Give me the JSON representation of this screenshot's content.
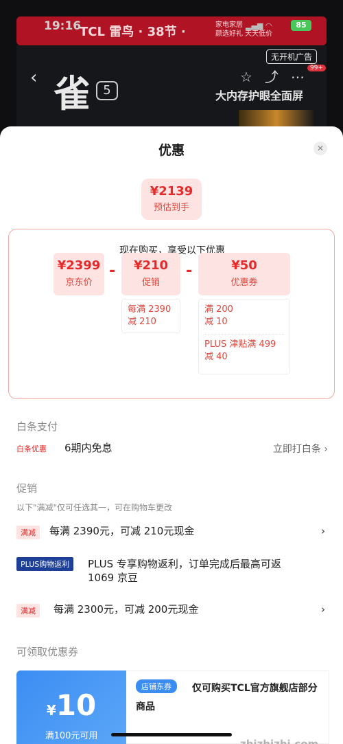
{
  "background": {
    "status_time": "19:16",
    "battery": "85",
    "ad_brand": "TCL 雷鸟 · 38节 ·",
    "ad_slogan_line1": "家电家居",
    "ad_slogan_line2": "颜选好礼 天天低价",
    "noad_tag": "无开机广告",
    "logo_char": "雀",
    "logo_num": "5",
    "badge": "99+",
    "tagline": "大内存护眼全面屏"
  },
  "sheet": {
    "title": "优惠",
    "estimate": {
      "price": "¥2139",
      "label": "预估到手"
    },
    "calc": {
      "heading": "现在购买，享受以下优惠",
      "jd": {
        "amount": "¥2399",
        "label": "京东价"
      },
      "promo": {
        "amount": "¥210",
        "label": "促销",
        "detail_line1": "每满 2390",
        "detail_line2": "减 210"
      },
      "coupon": {
        "amount": "¥50",
        "label": "优惠券",
        "detail_a1": "满 200",
        "detail_a2": "减 10",
        "detail_b1": "PLUS 津贴满 499",
        "detail_b2": "减 40"
      },
      "minus": "-"
    },
    "baitiao": {
      "title": "白条支付",
      "tag": "白条优惠",
      "text": "6期内免息",
      "link": "立即打白条"
    },
    "promotion": {
      "title": "促销",
      "note": "以下\"满减\"仅可任选其一，可在购物车更改",
      "row1_tag": "满减",
      "row1_text": "每满 2390元，可减 210元现金",
      "row2_tag": "PLUS购物返利",
      "row2_text_line1": "PLUS 专享购物返利，订单完成后最高可返",
      "row2_text_line2": "1069 京豆",
      "row3_tag": "满减",
      "row3_text": "每满 2300元，可减 200元现金"
    },
    "coupons": {
      "title": "可领取优惠券",
      "symbol": "¥",
      "amount": "10",
      "condition": "满100元可用",
      "tag": "店铺东券",
      "desc": "仅可购买TCL官方旗舰店部分商品"
    }
  },
  "watermark": "zhizhizhi.com"
}
